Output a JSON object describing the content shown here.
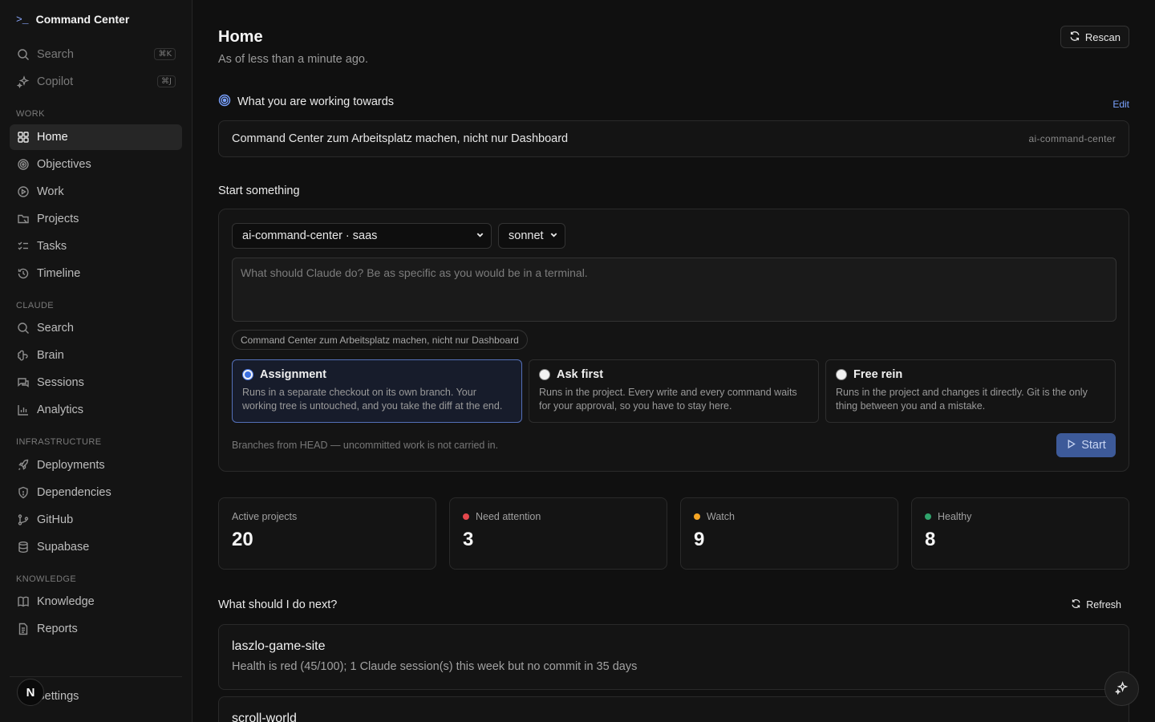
{
  "app": {
    "title": "Command Center"
  },
  "sidebar": {
    "top": [
      {
        "label": "Search",
        "kbd": "⌘K"
      },
      {
        "label": "Copilot",
        "kbd": "⌘J"
      }
    ],
    "sections": {
      "work": "WORK",
      "claude": "CLAUDE",
      "infrastructure": "INFRASTRUCTURE",
      "knowledge": "KNOWLEDGE"
    },
    "work": [
      "Home",
      "Objectives",
      "Work",
      "Projects",
      "Tasks",
      "Timeline"
    ],
    "claude": [
      "Search",
      "Brain",
      "Sessions",
      "Analytics"
    ],
    "infrastructure": [
      "Deployments",
      "Dependencies",
      "GitHub",
      "Supabase"
    ],
    "knowledge": [
      "Knowledge",
      "Reports"
    ],
    "settings": "Settings",
    "avatar": "N"
  },
  "header": {
    "title": "Home",
    "subtitle": "As of less than a minute ago.",
    "rescan": "Rescan"
  },
  "goal": {
    "heading": "What you are working towards",
    "edit": "Edit",
    "text": "Command Center zum Arbeitsplatz machen, nicht nur Dashboard",
    "tag": "ai-command-center"
  },
  "start": {
    "title": "Start something",
    "project": "ai-command-center · saas",
    "model": "sonnet",
    "placeholder": "What should Claude do? Be as specific as you would be in a terminal.",
    "chip": "Command Center zum Arbeitsplatz machen, nicht nur Dashboard",
    "modes": [
      {
        "title": "Assignment",
        "desc": "Runs in a separate checkout on its own branch. Your working tree is untouched, and you take the diff at the end.",
        "selected": true
      },
      {
        "title": "Ask first",
        "desc": "Runs in the project. Every write and every command waits for your approval, so you have to stay here.",
        "selected": false
      },
      {
        "title": "Free rein",
        "desc": "Runs in the project and changes it directly. Git is the only thing between you and a mistake.",
        "selected": false
      }
    ],
    "note": "Branches from HEAD — uncommitted work is not carried in.",
    "button": "Start"
  },
  "stats": [
    {
      "label": "Active projects",
      "value": "20",
      "color": ""
    },
    {
      "label": "Need attention",
      "value": "3",
      "color": "#e5484d"
    },
    {
      "label": "Watch",
      "value": "9",
      "color": "#f5a524"
    },
    {
      "label": "Healthy",
      "value": "8",
      "color": "#30a46c"
    }
  ],
  "next": {
    "title": "What should I do next?",
    "refresh": "Refresh",
    "items": [
      {
        "name": "laszlo-game-site",
        "desc": "Health is red (45/100); 1 Claude session(s) this week but no commit in 35 days"
      },
      {
        "name": "scroll-world",
        "desc": ""
      }
    ]
  }
}
